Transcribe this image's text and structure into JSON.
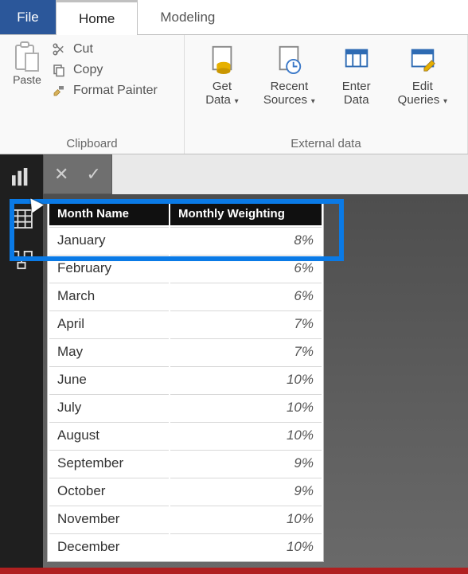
{
  "tabs": {
    "file": "File",
    "home": "Home",
    "modeling": "Modeling"
  },
  "ribbon": {
    "clipboard": {
      "label": "Clipboard",
      "paste": "Paste",
      "cut": "Cut",
      "copy": "Copy",
      "format_painter": "Format Painter"
    },
    "external": {
      "label": "External data",
      "get_data_l1": "Get",
      "get_data_l2": "Data",
      "recent_l1": "Recent",
      "recent_l2": "Sources",
      "enter_l1": "Enter",
      "enter_l2": "Data",
      "edit_l1": "Edit",
      "edit_l2": "Queries"
    }
  },
  "table": {
    "col_month": "Month Name",
    "col_weight": "Monthly Weighting",
    "rows": [
      {
        "month": "January",
        "weight": "8%"
      },
      {
        "month": "February",
        "weight": "6%"
      },
      {
        "month": "March",
        "weight": "6%"
      },
      {
        "month": "April",
        "weight": "7%"
      },
      {
        "month": "May",
        "weight": "7%"
      },
      {
        "month": "June",
        "weight": "10%"
      },
      {
        "month": "July",
        "weight": "10%"
      },
      {
        "month": "August",
        "weight": "10%"
      },
      {
        "month": "September",
        "weight": "9%"
      },
      {
        "month": "October",
        "weight": "9%"
      },
      {
        "month": "November",
        "weight": "10%"
      },
      {
        "month": "December",
        "weight": "10%"
      }
    ]
  },
  "chart_data": {
    "type": "table",
    "title": "Monthly Weighting",
    "columns": [
      "Month Name",
      "Monthly Weighting"
    ],
    "categories": [
      "January",
      "February",
      "March",
      "April",
      "May",
      "June",
      "July",
      "August",
      "September",
      "October",
      "November",
      "December"
    ],
    "values": [
      8,
      6,
      6,
      7,
      7,
      10,
      10,
      10,
      9,
      9,
      10,
      10
    ],
    "unit": "%"
  }
}
